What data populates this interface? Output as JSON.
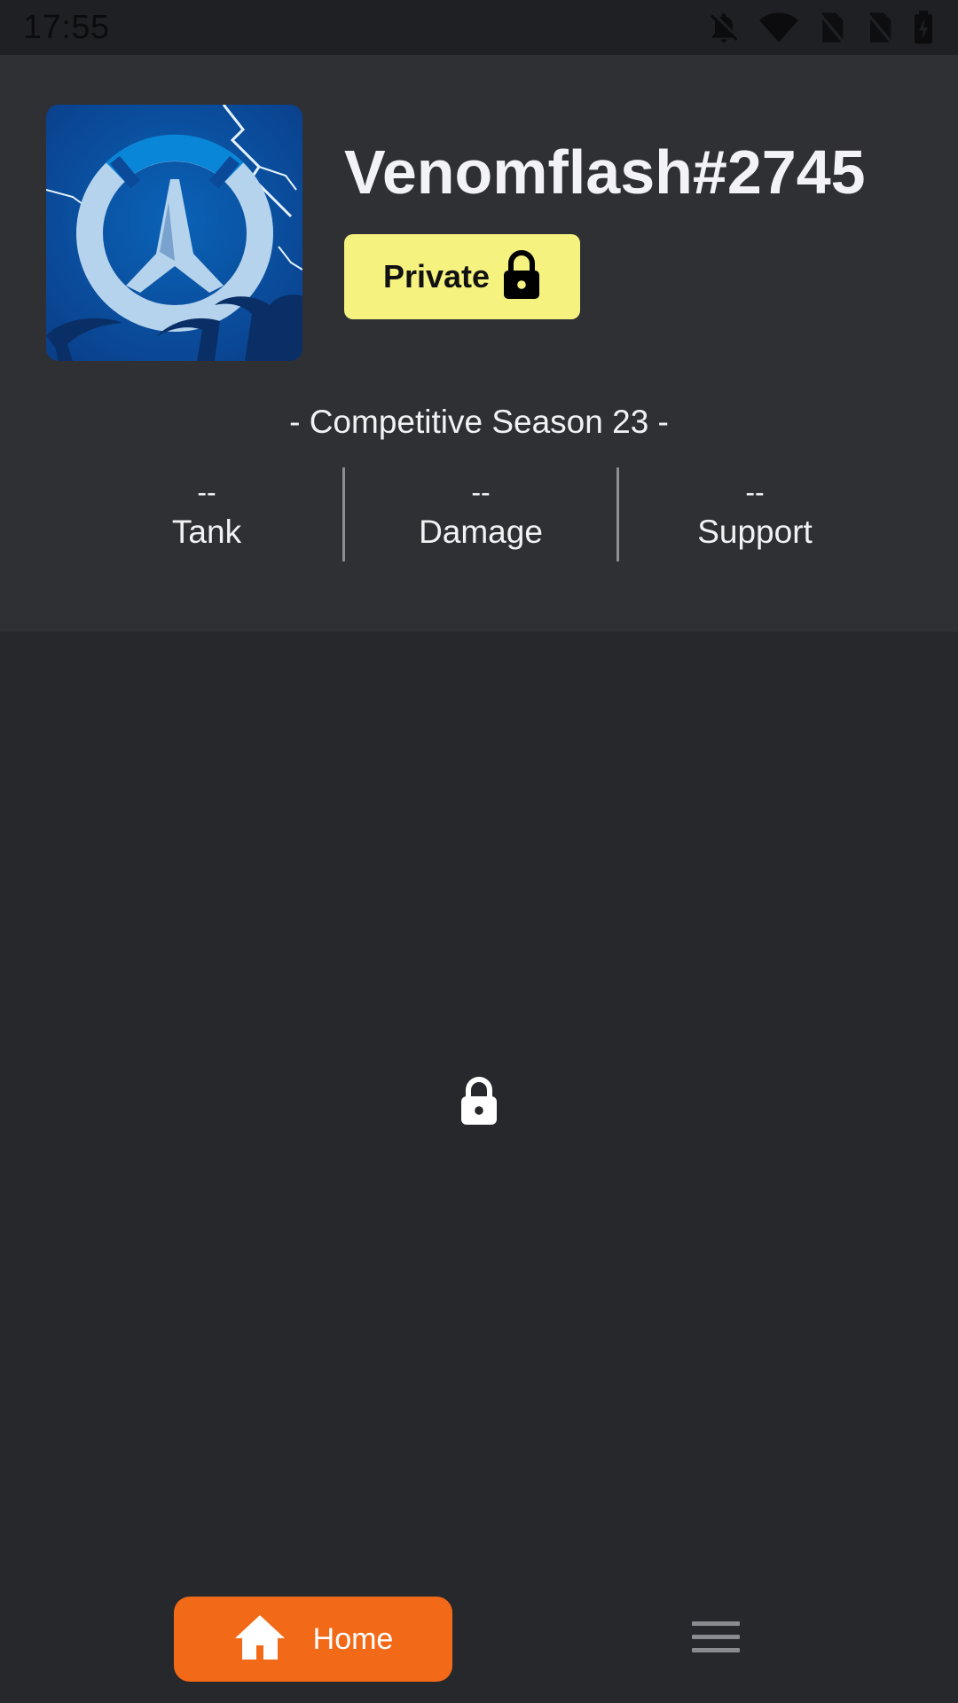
{
  "status_bar": {
    "time": "17:55",
    "icons": [
      "notifications-off-icon",
      "wifi-icon",
      "no-sim-icon",
      "no-sim-icon",
      "battery-charging-icon"
    ]
  },
  "profile": {
    "username": "Venomflash#2745",
    "privacy_label": "Private",
    "avatar": "overwatch-logo-storm-icon"
  },
  "competitive": {
    "season_title": "- Competitive Season 23 -",
    "roles": [
      {
        "rank": "--",
        "name": "Tank"
      },
      {
        "rank": "--",
        "name": "Damage"
      },
      {
        "rank": "--",
        "name": "Support"
      }
    ]
  },
  "content": {
    "center_icon": "lock-icon"
  },
  "nav": {
    "home_label": "Home",
    "menu_icon": "hamburger-menu-icon"
  },
  "colors": {
    "background": "#27282c",
    "header_panel": "#2f3034",
    "private_badge": "#f5f27f",
    "home_button": "#f26a18"
  }
}
